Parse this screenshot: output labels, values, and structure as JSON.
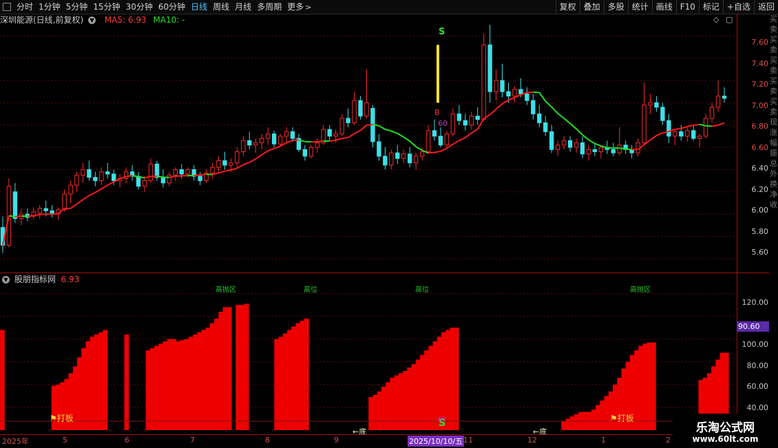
{
  "toolbar": {
    "periods": [
      "分时",
      "1分钟",
      "5分钟",
      "15分钟",
      "30分钟",
      "60分钟",
      "日线",
      "周线",
      "月线",
      "多周期",
      "更多"
    ],
    "active_period": "日线",
    "right_buttons": [
      "复权",
      "叠加",
      "多股",
      "统计",
      "画线",
      "F10",
      "标记",
      "+自选",
      "返回"
    ]
  },
  "main_pane": {
    "stock_title": "深圳能源(日线,前复权)",
    "ma5_label": "MA5: 6.93",
    "ma10_label": "MA10: -",
    "price_axis": [
      "7.60",
      "7.40",
      "7.20",
      "7.00",
      "6.80",
      "6.60",
      "6.40",
      "6.20",
      "6.00",
      "5.80",
      "5.60"
    ],
    "annotation_s": "S",
    "annotation_b": "B",
    "annotation_60": "60"
  },
  "indicator_pane": {
    "name": "股朋指标网",
    "value": "6.93",
    "axis": [
      "120.00",
      "100.00",
      "80.00",
      "60.00",
      "40.00",
      "20.00"
    ],
    "current_value": "90.60",
    "stage_labels": [
      "高抛区",
      "高位",
      "高位",
      "高抛区"
    ],
    "board_label": "打板",
    "bottom_label": "←底",
    "s_label": "S",
    "sixty_label": "60"
  },
  "date_axis": {
    "labels": [
      "2025年",
      "5",
      "6",
      "7",
      "8",
      "9",
      "2025/10/10/五",
      "11",
      "12",
      "1",
      "2"
    ],
    "selected": "2025/10/10/五"
  },
  "brand": {
    "title": "乐淘公式网",
    "url": "www.60lt.com"
  },
  "colors": {
    "up": "#ff2a2a",
    "down": "#3de0e8",
    "ma_up": "#ff1a1a",
    "ma_down": "#22e022",
    "bar": "#ee0000",
    "accent": "#4fc3ff"
  },
  "chart_data": [
    {
      "type": "candlestick",
      "title": "深圳能源(日线,前复权)",
      "ylim": [
        5.5,
        7.75
      ],
      "ohlc": [
        [
          5.88,
          5.98,
          5.65,
          5.72
        ],
        [
          5.72,
          6.32,
          5.7,
          6.25
        ],
        [
          6.2,
          6.28,
          5.92,
          5.96
        ],
        [
          5.96,
          6.05,
          5.9,
          6.0
        ],
        [
          6.0,
          6.05,
          5.94,
          5.97
        ],
        [
          5.98,
          6.06,
          5.95,
          6.02
        ],
        [
          6.01,
          6.08,
          5.96,
          6.05
        ],
        [
          6.05,
          6.12,
          5.98,
          6.03
        ],
        [
          6.03,
          6.08,
          5.97,
          6.0
        ],
        [
          6.0,
          6.06,
          5.95,
          6.04
        ],
        [
          6.04,
          6.22,
          6.02,
          6.18
        ],
        [
          6.18,
          6.3,
          6.1,
          6.26
        ],
        [
          6.26,
          6.38,
          6.2,
          6.35
        ],
        [
          6.35,
          6.46,
          6.28,
          6.4
        ],
        [
          6.4,
          6.48,
          6.3,
          6.33
        ],
        [
          6.33,
          6.38,
          6.25,
          6.3
        ],
        [
          6.3,
          6.42,
          6.26,
          6.38
        ],
        [
          6.38,
          6.46,
          6.32,
          6.36
        ],
        [
          6.36,
          6.4,
          6.26,
          6.3
        ],
        [
          6.3,
          6.36,
          6.24,
          6.32
        ],
        [
          6.32,
          6.42,
          6.28,
          6.38
        ],
        [
          6.38,
          6.44,
          6.3,
          6.34
        ],
        [
          6.34,
          6.38,
          6.22,
          6.25
        ],
        [
          6.25,
          6.34,
          6.2,
          6.3
        ],
        [
          6.3,
          6.5,
          6.28,
          6.45
        ],
        [
          6.45,
          6.48,
          6.3,
          6.33
        ],
        [
          6.33,
          6.4,
          6.24,
          6.28
        ],
        [
          6.28,
          6.38,
          6.25,
          6.35
        ],
        [
          6.35,
          6.42,
          6.3,
          6.4
        ],
        [
          6.4,
          6.45,
          6.32,
          6.36
        ],
        [
          6.36,
          6.42,
          6.33,
          6.4
        ],
        [
          6.4,
          6.44,
          6.3,
          6.34
        ],
        [
          6.34,
          6.38,
          6.26,
          6.3
        ],
        [
          6.3,
          6.4,
          6.28,
          6.37
        ],
        [
          6.37,
          6.46,
          6.32,
          6.42
        ],
        [
          6.42,
          6.52,
          6.38,
          6.48
        ],
        [
          6.48,
          6.56,
          6.4,
          6.44
        ],
        [
          6.44,
          6.5,
          6.38,
          6.46
        ],
        [
          6.46,
          6.6,
          6.42,
          6.56
        ],
        [
          6.56,
          6.7,
          6.52,
          6.66
        ],
        [
          6.66,
          6.74,
          6.58,
          6.62
        ],
        [
          6.62,
          6.68,
          6.55,
          6.64
        ],
        [
          6.64,
          6.72,
          6.58,
          6.68
        ],
        [
          6.68,
          6.78,
          6.62,
          6.72
        ],
        [
          6.72,
          6.75,
          6.6,
          6.63
        ],
        [
          6.63,
          6.72,
          6.6,
          6.7
        ],
        [
          6.7,
          6.78,
          6.64,
          6.74
        ],
        [
          6.74,
          6.78,
          6.65,
          6.68
        ],
        [
          6.68,
          6.72,
          6.56,
          6.58
        ],
        [
          6.58,
          6.62,
          6.48,
          6.52
        ],
        [
          6.52,
          6.62,
          6.5,
          6.6
        ],
        [
          6.6,
          6.68,
          6.55,
          6.64
        ],
        [
          6.64,
          6.8,
          6.62,
          6.76
        ],
        [
          6.76,
          6.8,
          6.66,
          6.7
        ],
        [
          6.7,
          6.76,
          6.64,
          6.72
        ],
        [
          6.72,
          6.9,
          6.7,
          6.86
        ],
        [
          6.86,
          6.95,
          6.78,
          6.82
        ],
        [
          6.82,
          7.1,
          6.8,
          7.02
        ],
        [
          7.02,
          7.06,
          6.85,
          6.88
        ],
        [
          6.88,
          7.3,
          6.86,
          7.0
        ],
        [
          6.95,
          6.98,
          6.6,
          6.65
        ],
        [
          6.65,
          6.72,
          6.48,
          6.52
        ],
        [
          6.52,
          6.6,
          6.4,
          6.44
        ],
        [
          6.44,
          6.58,
          6.4,
          6.55
        ],
        [
          6.55,
          6.62,
          6.45,
          6.5
        ],
        [
          6.5,
          6.58,
          6.46,
          6.54
        ],
        [
          6.54,
          6.6,
          6.42,
          6.46
        ],
        [
          6.46,
          6.55,
          6.4,
          6.52
        ],
        [
          6.52,
          6.6,
          6.48,
          6.56
        ],
        [
          6.56,
          6.8,
          6.54,
          6.75
        ],
        [
          6.75,
          6.85,
          6.66,
          6.7
        ],
        [
          6.7,
          6.78,
          6.6,
          6.62
        ],
        [
          6.62,
          6.75,
          6.6,
          6.72
        ],
        [
          6.72,
          6.95,
          6.7,
          6.9
        ],
        [
          6.9,
          6.98,
          6.8,
          6.84
        ],
        [
          6.84,
          6.9,
          6.75,
          6.8
        ],
        [
          6.8,
          6.92,
          6.76,
          6.88
        ],
        [
          6.88,
          6.96,
          6.8,
          6.85
        ],
        [
          6.85,
          7.62,
          6.84,
          7.52
        ],
        [
          7.52,
          7.7,
          7.0,
          7.1
        ],
        [
          7.1,
          7.3,
          7.02,
          7.2
        ],
        [
          7.2,
          7.35,
          7.05,
          7.1
        ],
        [
          7.1,
          7.18,
          7.0,
          7.06
        ],
        [
          7.06,
          7.15,
          7.0,
          7.12
        ],
        [
          7.12,
          7.22,
          7.05,
          7.08
        ],
        [
          7.08,
          7.14,
          6.98,
          7.02
        ],
        [
          7.02,
          7.08,
          6.85,
          6.9
        ],
        [
          6.9,
          6.98,
          6.78,
          6.82
        ],
        [
          6.82,
          6.88,
          6.7,
          6.74
        ],
        [
          6.74,
          6.8,
          6.55,
          6.58
        ],
        [
          6.58,
          6.66,
          6.52,
          6.62
        ],
        [
          6.62,
          6.7,
          6.58,
          6.66
        ],
        [
          6.66,
          6.7,
          6.56,
          6.6
        ],
        [
          6.6,
          6.68,
          6.55,
          6.64
        ],
        [
          6.64,
          6.7,
          6.5,
          6.54
        ],
        [
          6.54,
          6.62,
          6.48,
          6.58
        ],
        [
          6.58,
          6.64,
          6.52,
          6.56
        ],
        [
          6.56,
          6.62,
          6.5,
          6.6
        ],
        [
          6.6,
          6.66,
          6.54,
          6.58
        ],
        [
          6.58,
          6.64,
          6.52,
          6.55
        ],
        [
          6.55,
          6.78,
          6.53,
          6.62
        ],
        [
          6.62,
          6.66,
          6.54,
          6.58
        ],
        [
          6.58,
          6.62,
          6.5,
          6.55
        ],
        [
          6.55,
          6.68,
          6.52,
          6.64
        ],
        [
          6.64,
          7.18,
          6.62,
          6.98
        ],
        [
          6.98,
          7.08,
          6.9,
          7.0
        ],
        [
          7.0,
          7.06,
          6.92,
          6.96
        ],
        [
          6.96,
          7.0,
          6.8,
          6.84
        ],
        [
          6.84,
          6.9,
          6.64,
          6.7
        ],
        [
          6.7,
          6.76,
          6.62,
          6.74
        ],
        [
          6.74,
          6.8,
          6.66,
          6.7
        ],
        [
          6.7,
          6.78,
          6.65,
          6.75
        ],
        [
          6.75,
          6.8,
          6.66,
          6.68
        ],
        [
          6.68,
          6.72,
          6.6,
          6.7
        ],
        [
          6.7,
          6.9,
          6.68,
          6.86
        ],
        [
          6.86,
          7.0,
          6.82,
          6.96
        ],
        [
          6.96,
          7.2,
          6.92,
          7.06
        ],
        [
          7.06,
          7.14,
          7.0,
          7.04
        ]
      ]
    },
    {
      "type": "bar",
      "title": "股朋指标网",
      "ylim": [
        0,
        130
      ],
      "values": [
        88,
        0,
        0,
        0,
        0,
        0,
        0,
        0,
        0,
        0,
        0,
        0,
        39,
        40,
        42,
        45,
        50,
        56,
        64,
        72,
        78,
        82,
        84,
        86,
        88,
        0,
        0,
        0,
        0,
        84,
        0,
        0,
        0,
        0,
        70,
        72,
        74,
        76,
        78,
        80,
        80,
        78,
        79,
        80,
        82,
        84,
        86,
        88,
        90,
        94,
        98,
        104,
        108,
        108,
        0,
        110,
        110,
        111,
        0,
        0,
        0,
        0,
        0,
        0,
        80,
        82,
        85,
        88,
        91,
        94,
        96,
        98,
        0,
        0,
        0,
        0,
        0,
        0,
        0,
        0,
        0,
        0,
        0,
        0,
        0,
        0,
        29,
        31,
        34,
        38,
        42,
        46,
        48,
        50,
        52,
        55,
        58,
        62,
        66,
        70,
        74,
        78,
        82,
        86,
        88,
        90,
        90,
        0,
        0,
        0,
        0,
        0,
        0,
        0,
        0,
        0,
        0,
        0,
        0,
        0,
        0,
        0,
        0,
        0,
        0,
        0,
        0,
        0,
        0,
        0,
        0,
        8,
        10,
        12,
        14,
        16,
        16,
        16,
        18,
        22,
        26,
        30,
        34,
        40,
        46,
        54,
        60,
        66,
        70,
        74,
        76,
        77,
        77,
        0,
        0,
        0,
        0,
        0,
        0,
        0,
        0,
        0,
        0,
        44,
        46,
        50,
        56,
        62,
        68,
        68
      ]
    }
  ]
}
